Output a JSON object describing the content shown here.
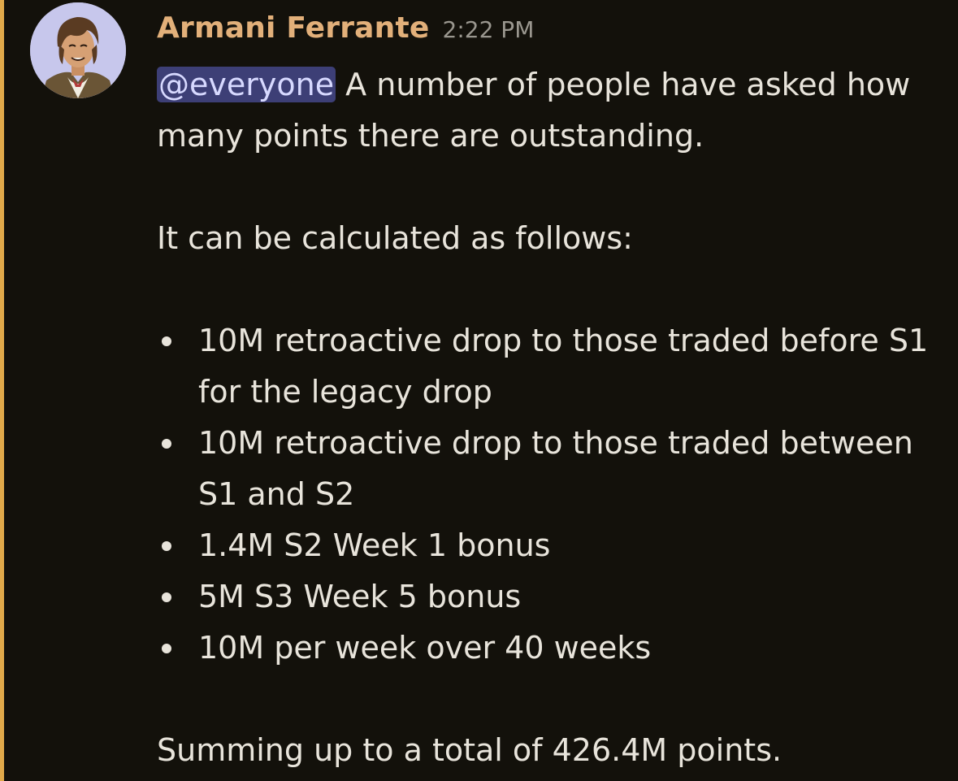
{
  "message": {
    "author": "Armani Ferrante",
    "timestamp": "2:22 PM",
    "mention": "@everyone",
    "intro": " A number of people have asked how many points there are outstanding.",
    "line2": "It can be calculated as follows:",
    "bullets": [
      "10M retroactive drop to those traded before S1 for the legacy drop",
      "10M retroactive drop to those traded between S1 and S2",
      "1.4M S2 Week 1 bonus",
      "5M S3 Week 5 bonus",
      "10M per week over 40 weeks"
    ],
    "summary": "Summing up to a total of 426.4M points."
  },
  "colors": {
    "background": "#13110b",
    "username": "#e2b07a",
    "timestamp": "#9a978f",
    "text": "#e8e4db",
    "mention_bg": "#3d3f76",
    "mention_text": "#d7d9ff",
    "highlight_bar": "#e0a94a",
    "avatar_bg": "#c7c7ec"
  },
  "avatar": {
    "icon": "user-avatar-illustration"
  }
}
